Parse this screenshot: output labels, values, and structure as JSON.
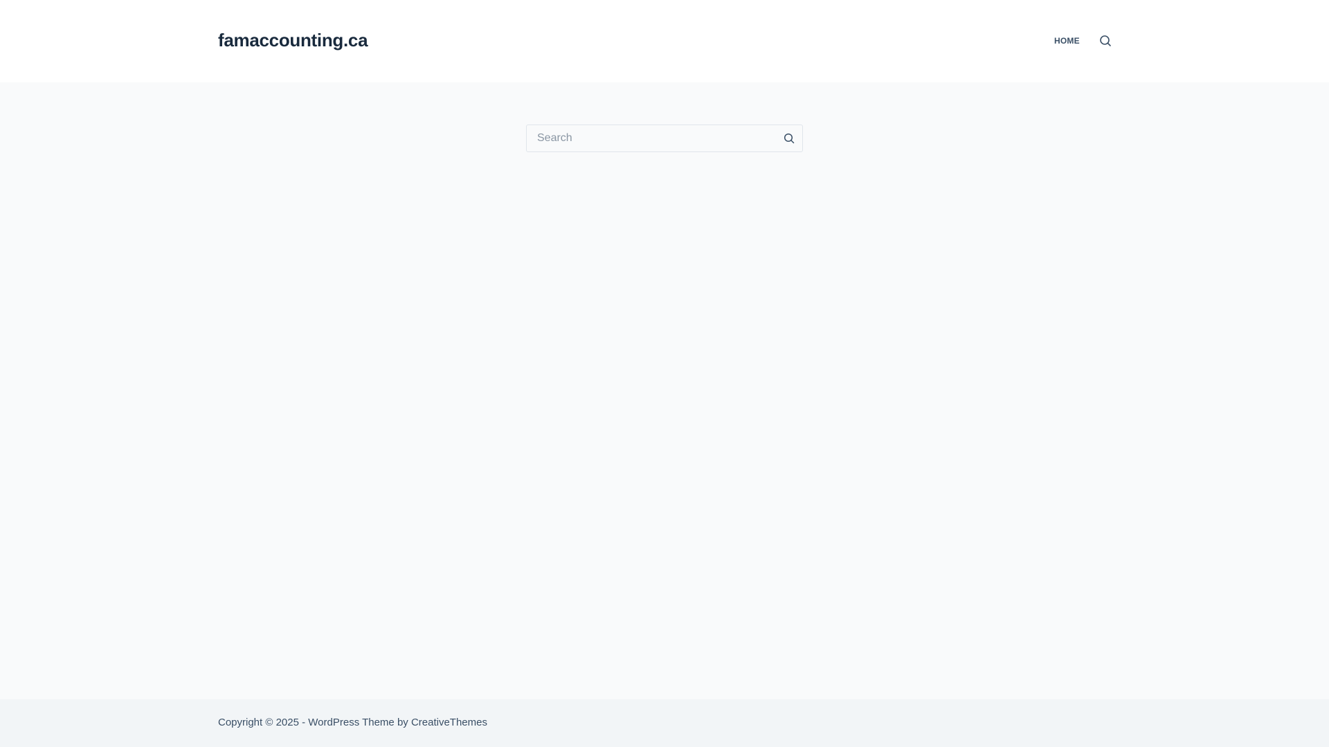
{
  "header": {
    "site_title": "famaccounting.ca",
    "nav": [
      {
        "label": "HOME"
      }
    ],
    "search_icon": "search-icon"
  },
  "main": {
    "search": {
      "placeholder": "Search",
      "value": "",
      "button_icon": "search-icon"
    }
  },
  "footer": {
    "copyright": "Copyright © 2025 - WordPress Theme by CreativeThemes"
  }
}
